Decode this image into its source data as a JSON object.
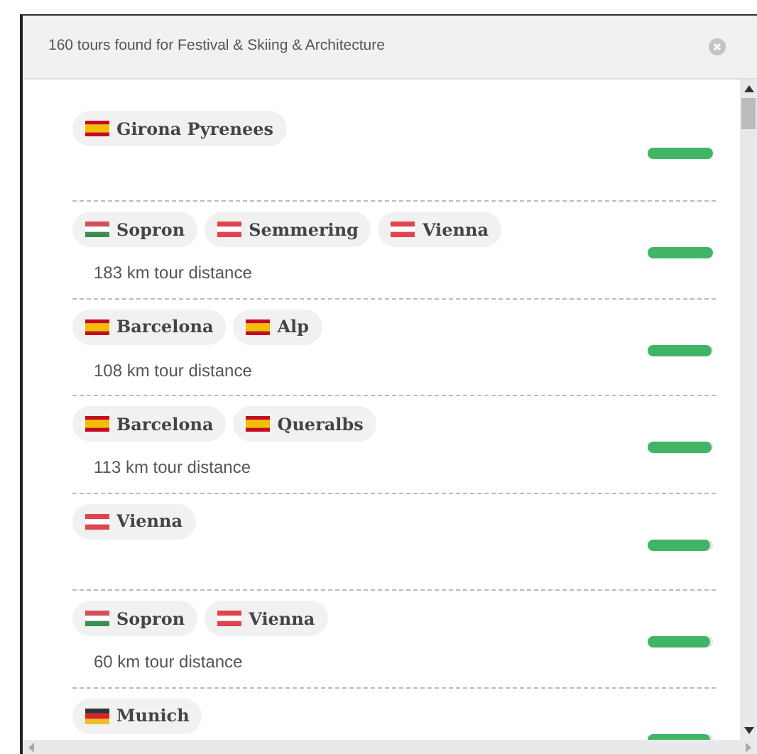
{
  "header": {
    "title": "160 tours found for Festival & Skiing & Architecture"
  },
  "tours": [
    {
      "places": [
        {
          "name": "Girona Pyrenees",
          "kind": "es"
        }
      ],
      "level": 1
    },
    {
      "places": [
        {
          "name": "Sopron",
          "kind": "hu"
        },
        {
          "name": "Semmering",
          "kind": "at"
        },
        {
          "name": "Vienna",
          "kind": "at"
        }
      ],
      "distance": "183 km tour distance",
      "level": 1
    },
    {
      "places": [
        {
          "name": "Barcelona",
          "kind": "es"
        },
        {
          "name": "Alp",
          "kind": "es"
        }
      ],
      "distance": "108 km tour distance",
      "level": 0.98
    },
    {
      "places": [
        {
          "name": "Barcelona",
          "kind": "es"
        },
        {
          "name": "Queralbs",
          "kind": "es"
        }
      ],
      "distance": "113 km tour distance",
      "level": 0.98
    },
    {
      "places": [
        {
          "name": "Vienna",
          "kind": "at"
        }
      ],
      "level": 0.96
    },
    {
      "places": [
        {
          "name": "Sopron",
          "kind": "hu"
        },
        {
          "name": "Vienna",
          "kind": "at"
        }
      ],
      "distance": "60 km tour distance",
      "level": 0.96
    },
    {
      "places": [
        {
          "name": "Munich",
          "kind": "de"
        }
      ],
      "level": 0.96
    }
  ]
}
